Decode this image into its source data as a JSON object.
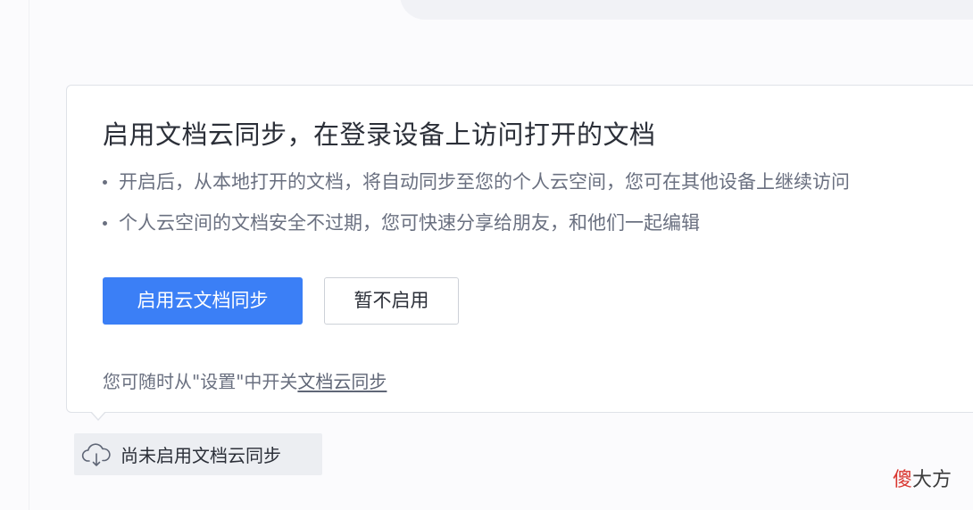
{
  "popover": {
    "title": "启用文档云同步，在登录设备上访问打开的文档",
    "bullets": [
      "开启后，从本地打开的文档，将自动同步至您的个人云空间，您可在其他设备上继续访问",
      "个人云空间的文档安全不过期，您可快速分享给朋友，和他们一起编辑"
    ],
    "enable_button": "启用云文档同步",
    "skip_button": "暂不启用",
    "footer_prefix": "您可随时从\"设置\"中开关",
    "footer_link": "文档云同步"
  },
  "status": {
    "icon": "cloud-sync-icon",
    "label": "尚未启用文档云同步"
  },
  "watermark": {
    "first_char": "傻",
    "rest": "大方"
  },
  "colors": {
    "accent": "#3b7ff6",
    "watermark_red": "#d9362f"
  }
}
